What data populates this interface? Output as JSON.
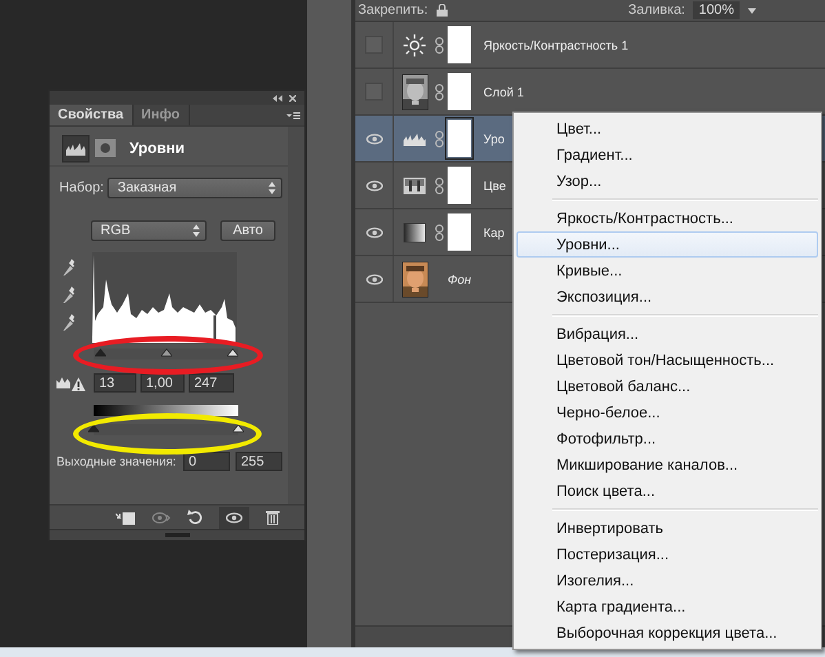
{
  "properties_panel": {
    "tabs": [
      {
        "label": "Свойства",
        "selected": true
      },
      {
        "label": "Инфо",
        "selected": false
      }
    ],
    "title": "Уровни",
    "preset": {
      "label": "Набор:",
      "value": "Заказная"
    },
    "channel": {
      "value": "RGB"
    },
    "auto_button": "Авто",
    "input_levels": [
      {
        "value": "13",
        "level": 0.05
      },
      {
        "value": "1,00",
        "level": 0.5
      },
      {
        "value": "247",
        "level": 0.96
      }
    ],
    "output_levels": {
      "label": "Выходные значения:",
      "values": [
        {
          "value": "0",
          "level": 0
        },
        {
          "value": "255",
          "level": 1
        }
      ]
    }
  },
  "layers_panel": {
    "lock_label": "Закрепить:",
    "fill_label": "Заливка:",
    "fill_value": "100%",
    "layers": [
      {
        "name": "Яркость/Контрастность 1",
        "visible": false,
        "selected": false,
        "kind": "brightness",
        "mask": true,
        "background": false
      },
      {
        "name": "Слой 1",
        "visible": false,
        "selected": false,
        "kind": "photo_bw",
        "mask": true,
        "background": false
      },
      {
        "name": "Уро",
        "visible": true,
        "selected": true,
        "kind": "levels",
        "mask": true,
        "background": false
      },
      {
        "name": "Цве",
        "visible": true,
        "selected": false,
        "kind": "color_balance",
        "mask": true,
        "background": false
      },
      {
        "name": "Кар",
        "visible": true,
        "selected": false,
        "kind": "gradient_map",
        "mask": true,
        "background": false
      },
      {
        "name": "Фон",
        "visible": true,
        "selected": false,
        "mask": false,
        "background": true
      }
    ]
  },
  "menu": {
    "groups": [
      {
        "items": [
          {
            "label": "Цвет...",
            "selected": false
          },
          {
            "label": "Градиент...",
            "selected": false
          },
          {
            "label": "Узор...",
            "selected": false
          }
        ]
      },
      {
        "items": [
          {
            "label": "Яркость/Контрастность...",
            "selected": false
          },
          {
            "label": "Уровни...",
            "selected": true
          },
          {
            "label": "Кривые...",
            "selected": false
          },
          {
            "label": "Экспозиция...",
            "selected": false
          }
        ]
      },
      {
        "items": [
          {
            "label": "Вибрация...",
            "selected": false
          },
          {
            "label": "Цветовой тон/Насыщенность...",
            "selected": false
          },
          {
            "label": "Цветовой баланс...",
            "selected": false
          },
          {
            "label": "Черно-белое...",
            "selected": false
          },
          {
            "label": "Фотофильтр...",
            "selected": false
          },
          {
            "label": "Микширование каналов...",
            "selected": false
          },
          {
            "label": "Поиск цвета...",
            "selected": false
          }
        ]
      },
      {
        "items": [
          {
            "label": "Инвертировать",
            "selected": false
          },
          {
            "label": "Постеризация...",
            "selected": false
          },
          {
            "label": "Изогелия...",
            "selected": false
          },
          {
            "label": "Карта градиента...",
            "selected": false
          },
          {
            "label": "Выборочная коррекция цвета...",
            "selected": false
          }
        ]
      }
    ]
  }
}
